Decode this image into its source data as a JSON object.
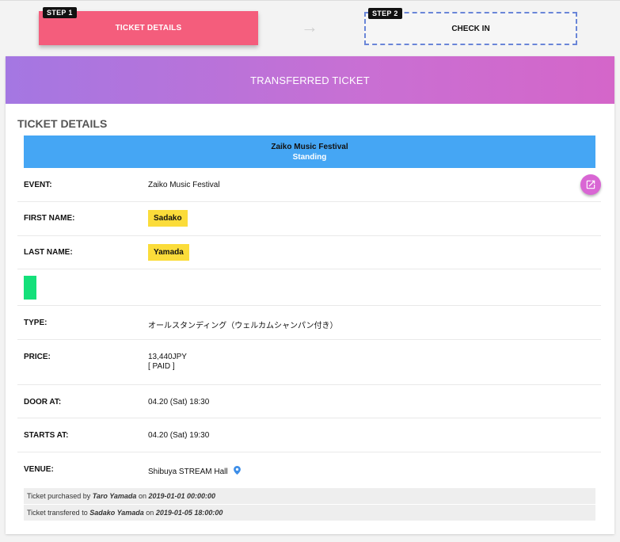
{
  "steps": {
    "step1": {
      "tag": "STEP 1",
      "label": "TICKET DETAILS"
    },
    "arrow": "→",
    "step2": {
      "tag": "STEP 2",
      "label": "CHECK IN"
    }
  },
  "banner": {
    "title": "TRANSFERRED TICKET"
  },
  "details": {
    "section_title": "TICKET DETAILS",
    "event_name": "Zaiko Music Festival",
    "ticket_class": "Standing",
    "rows": {
      "event": {
        "label": "EVENT:",
        "value": "Zaiko Music Festival"
      },
      "first_name": {
        "label": "FIRST NAME:",
        "value": "Sadako"
      },
      "last_name": {
        "label": "LAST NAME:",
        "value": "Yamada"
      },
      "type": {
        "label": "TYPE:",
        "value": "オールスタンディング（ウェルカムシャンパン付き）"
      },
      "price": {
        "label": "PRICE:",
        "amount": "13,440JPY",
        "status": "[ PAID ]"
      },
      "door": {
        "label": "DOOR AT:",
        "value": "04.20 (Sat) 18:30"
      },
      "starts": {
        "label": "STARTS AT:",
        "value": "04.20 (Sat) 19:30"
      },
      "venue": {
        "label": "VENUE:",
        "value": "Shibuya STREAM Hall"
      }
    }
  },
  "notes": {
    "purchase": {
      "prefix": "Ticket purchased by",
      "name": "Taro Yamada",
      "on": "on",
      "date": "2019-01-01 00:00:00"
    },
    "transfer": {
      "prefix": "Ticket transfered to",
      "name": "Sadako Yamada",
      "on": "on",
      "date": "2019-01-05 18:00:00"
    }
  },
  "colors": {
    "step1_bg": "#f45d7c",
    "step2_border": "#6a86d8",
    "banner_gradient": [
      "#a477e2",
      "#d466c9"
    ],
    "event_box": "#45a6f4",
    "name_chip": "#fbdc3a",
    "status_block": "#14e07a",
    "external_button": "#d966d4"
  },
  "icons": {
    "external_link": "external-link-icon",
    "venue": "map-pin-icon",
    "next": "arrow-right-icon"
  }
}
